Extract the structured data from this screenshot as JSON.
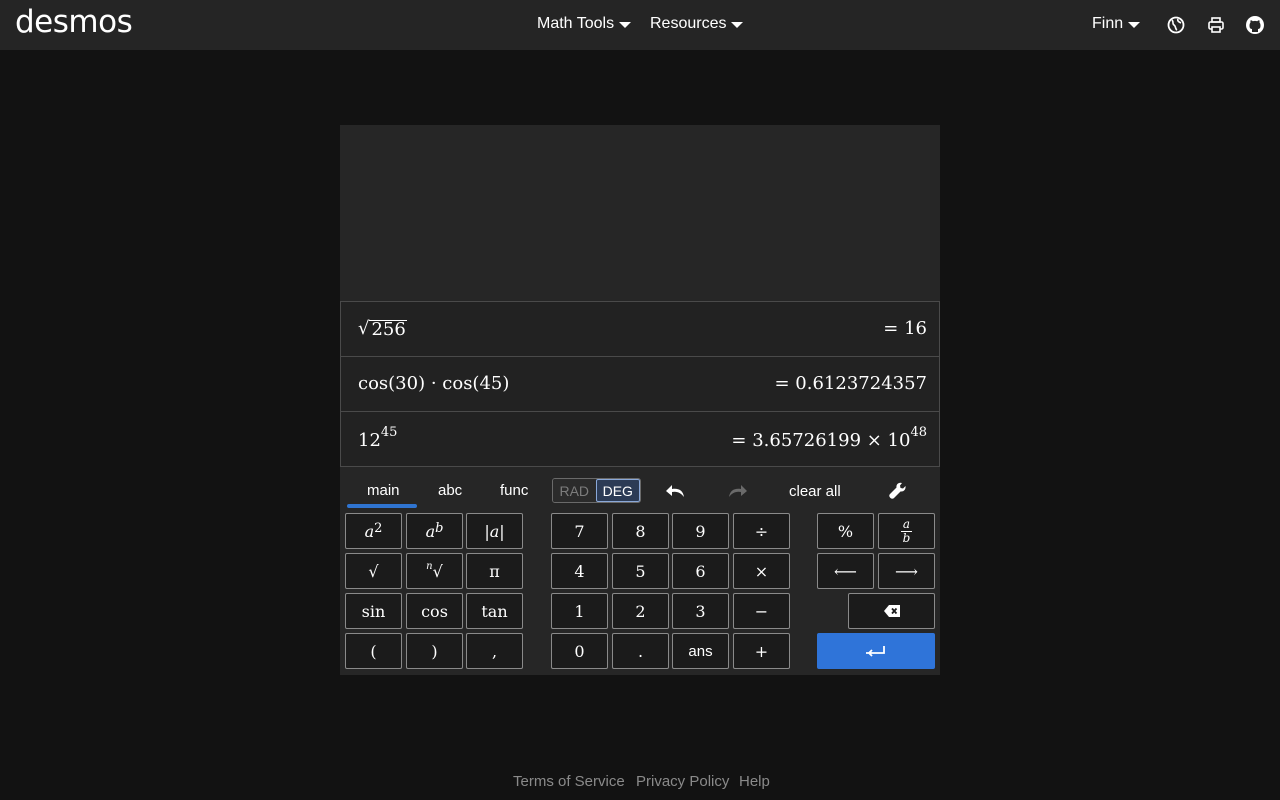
{
  "header": {
    "logo": "desmos",
    "menus": [
      {
        "label": "Math Tools"
      },
      {
        "label": "Resources"
      }
    ],
    "user": "Finn",
    "icons": [
      "globe-icon",
      "print-icon",
      "github-icon"
    ]
  },
  "history": [
    {
      "expression": "256",
      "expression_type": "sqrt",
      "result": "= 16"
    },
    {
      "expression": "cos(30) · cos(45)",
      "result": "= 0.6123724357"
    },
    {
      "expression_base": "12",
      "expression_exp": "45",
      "result_prefix": "= 3.65726199 × 10",
      "result_exp": "48"
    }
  ],
  "keypad": {
    "tabs": [
      "main",
      "abc",
      "func"
    ],
    "active_tab": "main",
    "angle_modes": [
      "RAD",
      "DEG"
    ],
    "active_angle": "DEG",
    "clear_all": "clear all",
    "functions": {
      "square": "a",
      "square_exp": "2",
      "power": "a",
      "power_exp": "b",
      "abs": "|a|",
      "sqrt": "√",
      "nth_root_index": "n",
      "nth_root": "√",
      "pi": "π",
      "sin": "sin",
      "cos": "cos",
      "tan": "tan",
      "lparen": "(",
      "rparen": ")",
      "comma": ","
    },
    "digits": {
      "d7": "7",
      "d8": "8",
      "d9": "9",
      "divide": "÷",
      "d4": "4",
      "d5": "5",
      "d6": "6",
      "times": "×",
      "d1": "1",
      "d2": "2",
      "d3": "3",
      "minus": "−",
      "d0": "0",
      "dot": ".",
      "ans": "ans",
      "plus": "+"
    },
    "right": {
      "percent": "%",
      "frac_num": "a",
      "frac_den": "b",
      "left_arrow": "⟵",
      "right_arrow": "⟶"
    }
  },
  "footer": {
    "links": [
      "Terms of Service",
      "Privacy Policy",
      "Help"
    ]
  },
  "colors": {
    "accent": "#2f74d9",
    "background": "#121212",
    "header": "#252525"
  }
}
